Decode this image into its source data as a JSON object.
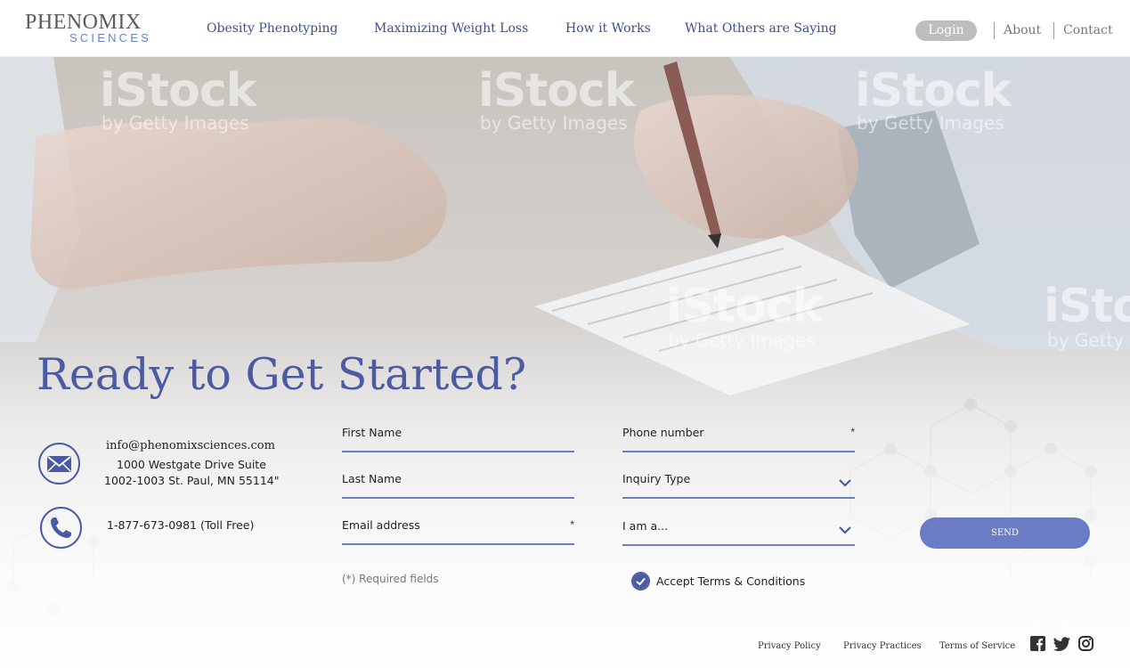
{
  "header": {
    "logo_line1": "PHENOMIX",
    "logo_line2": "SCIENCES",
    "nav": [
      "Obesity Phenotyping",
      "Maximizing Weight Loss",
      "How it Works",
      "What Others are Saying"
    ],
    "login_label": "Login",
    "about_label": "About",
    "contact_label": "Contact"
  },
  "watermarks": {
    "brand": "iStock",
    "sub": "by Getty Images"
  },
  "hero": {
    "title": "Ready to Get Started?"
  },
  "contact": {
    "email": "info@phenomixsciences.com",
    "address_line1": "1000 Westgate Drive Suite",
    "address_line2": "1002-1003 St. Paul, MN 55114\"",
    "phone": "1-877-673-0981 (Toll Free)",
    "email_icon": "envelope-icon",
    "phone_icon": "phone-icon"
  },
  "form": {
    "first_name_placeholder": "First Name",
    "last_name_placeholder": "Last Name",
    "email_placeholder": "Email address",
    "phone_placeholder": "Phone number",
    "inquiry_placeholder": "Inquiry Type",
    "iam_placeholder": "I am a...",
    "required_marker": "*",
    "required_note": "(*) Required fields",
    "accept_terms": "Accept Terms & Conditions",
    "send_label": "SEND"
  },
  "footer": {
    "privacy_policy": "Privacy Policy",
    "privacy_practices": "Privacy Practices",
    "terms": "Terms of Service",
    "social_icons": [
      "facebook-icon",
      "twitter-icon",
      "instagram-icon"
    ]
  },
  "colors": {
    "accent": "#4a5ba4",
    "button": "#6a7cc6",
    "login_bg": "#bdbdbd"
  }
}
